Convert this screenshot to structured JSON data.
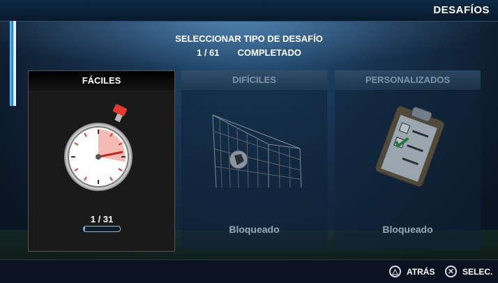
{
  "screen_title": "DESAFÍOS",
  "header": {
    "subtitle": "SELECCIONAR TIPO DE DESAFÍO",
    "progress": "1 / 61",
    "progress_label": "COMPLETADO"
  },
  "cards": [
    {
      "title": "FÁCILES",
      "count": "1 / 31",
      "progress_fraction": 0.032,
      "selected": true
    },
    {
      "title": "DIFÍCILES",
      "status": "Bloqueado"
    },
    {
      "title": "PERSONALIZADOS",
      "status": "Bloqueado"
    }
  ],
  "footer": {
    "back_label": "ATRÁS",
    "back_icon": "triangle-icon",
    "select_label": "SELEC.",
    "select_icon": "cross-icon"
  }
}
